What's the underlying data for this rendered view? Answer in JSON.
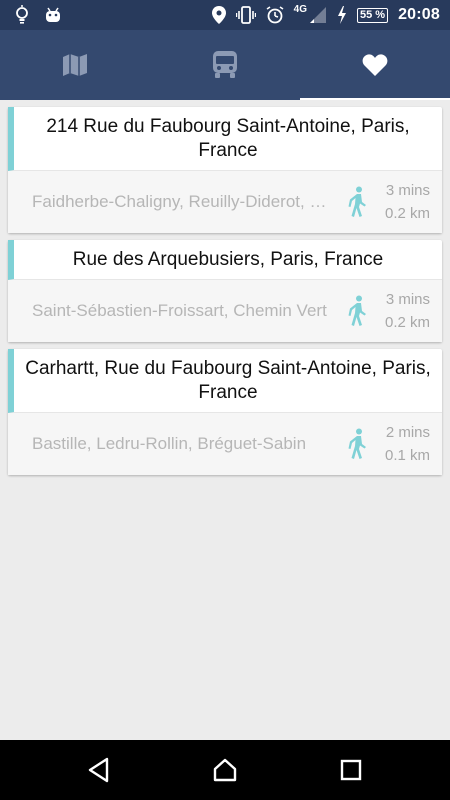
{
  "status_bar": {
    "network": "4G",
    "battery": "55 %",
    "time": "20:08"
  },
  "tabs": [
    {
      "icon": "map-icon",
      "active": false
    },
    {
      "icon": "bus-icon",
      "active": false
    },
    {
      "icon": "heart-icon",
      "active": true
    }
  ],
  "accent_color": "#7fd1d6",
  "favorites": [
    {
      "title": "214 Rue du Faubourg Saint-Antoine, Paris, France",
      "stops": "Faidherbe-Chaligny, Reuilly-Diderot, Nation",
      "time": "3 mins",
      "distance": "0.2 km"
    },
    {
      "title": "Rue des Arquebusiers, Paris, France",
      "stops": "Saint-Sébastien-Froissart, Chemin Vert",
      "time": "3 mins",
      "distance": "0.2 km"
    },
    {
      "title": "Carhartt, Rue du Faubourg Saint-Antoine, Paris, France",
      "stops": "Bastille, Ledru-Rollin, Bréguet-Sabin",
      "time": "2 mins",
      "distance": "0.1 km"
    }
  ]
}
